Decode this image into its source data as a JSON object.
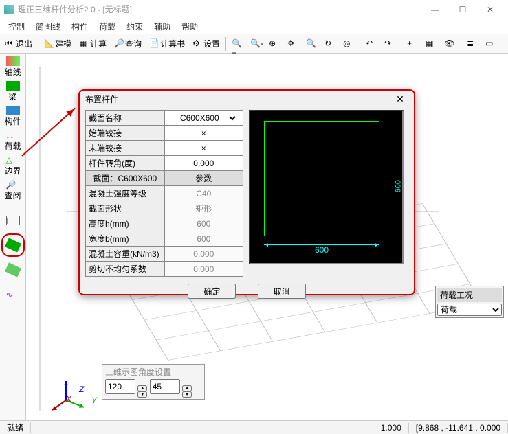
{
  "window": {
    "title": "理正三维杆件分析2.0 - [无标题]"
  },
  "menu": [
    "控制",
    "简图线",
    "构件",
    "荷载",
    "约束",
    "辅助",
    "帮助"
  ],
  "toolbar_text": {
    "exit": "退出",
    "model": "建模",
    "calc": "计算",
    "query": "查询",
    "calcbook": "计算书",
    "setting": "设置"
  },
  "vbar": [
    "轴线",
    "梁",
    "构件",
    "荷载",
    "边界",
    "查阅"
  ],
  "float_panel": {
    "header": "荷载工况",
    "value": "荷载"
  },
  "angle": {
    "header": "三维示图角度设置",
    "a": "120",
    "b": "45"
  },
  "status": {
    "ready": "就绪",
    "scale": "1.000",
    "coord": "[9.868 , -11.641 , 0.000"
  },
  "dialog": {
    "title": "布置杆件",
    "rows_top": [
      {
        "label": "截面名称",
        "value": "C600X600",
        "type": "select"
      },
      {
        "label": "始端铰接",
        "value": "×"
      },
      {
        "label": "末端铰接",
        "value": "×"
      },
      {
        "label": "杆件转角(度)",
        "value": "0.000"
      }
    ],
    "section_header": {
      "left": "截面：C600X600",
      "right": "参数"
    },
    "rows_bottom": [
      {
        "label": "混凝土强度等级",
        "value": "C40"
      },
      {
        "label": "截面形状",
        "value": "矩形"
      },
      {
        "label": "高度h(mm)",
        "value": "600"
      },
      {
        "label": "宽度b(mm)",
        "value": "600"
      },
      {
        "label": "混凝土容重(kN/m3)",
        "value": "0.000"
      },
      {
        "label": "剪切不均匀系数",
        "value": "0.000"
      }
    ],
    "ok": "确定",
    "cancel": "取消",
    "dim": "600"
  }
}
